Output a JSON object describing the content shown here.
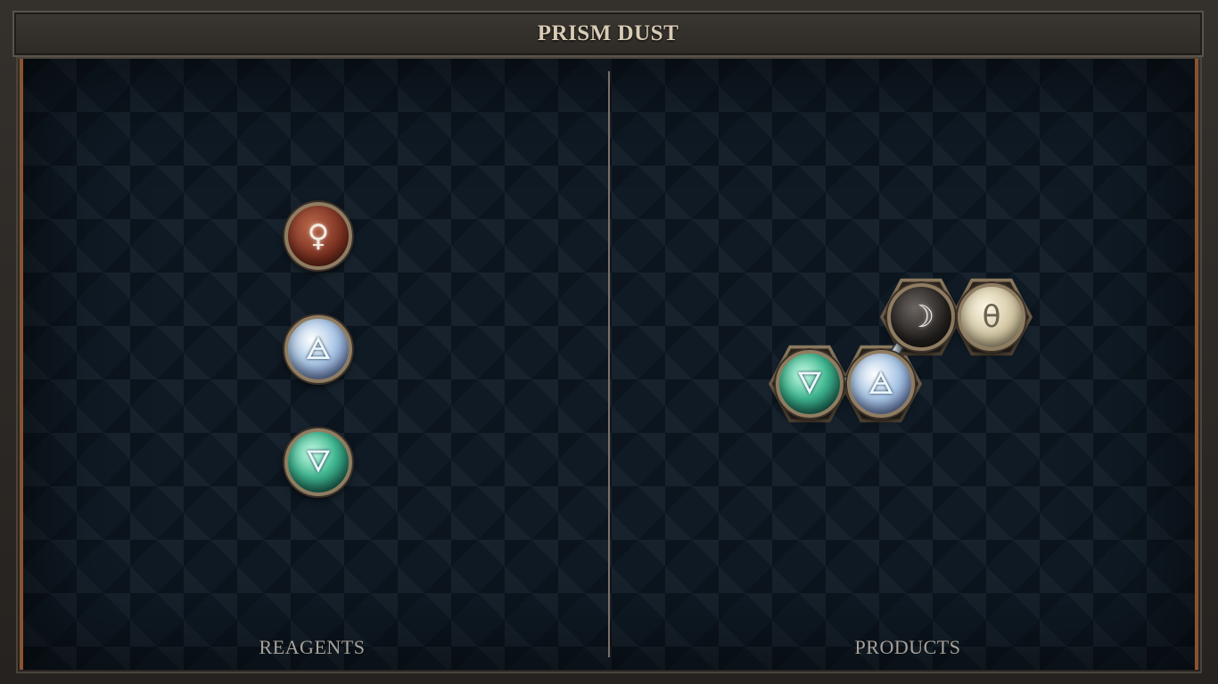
{
  "title": "PRISM DUST",
  "reagents": {
    "label": "REAGENTS",
    "atoms": [
      {
        "element": "copper",
        "glyph": "♀",
        "icon": "copper-icon"
      },
      {
        "element": "air",
        "glyph": "🜁",
        "icon": "air-icon"
      },
      {
        "element": "water",
        "glyph": "🜄",
        "icon": "water-icon"
      }
    ]
  },
  "products": {
    "label": "PRODUCTS",
    "atoms": [
      {
        "element": "water",
        "glyph": "🜄",
        "icon": "water-icon"
      },
      {
        "element": "air",
        "glyph": "🜁",
        "icon": "air-icon"
      },
      {
        "element": "silver",
        "glyph": "☽",
        "icon": "moon-icon"
      },
      {
        "element": "earth",
        "glyph": "θ",
        "icon": "earth-icon"
      }
    ]
  },
  "colors": {
    "frame_accent": "#8a5330",
    "board": "#0f1a24",
    "label_text": "#a8a29a",
    "title_text": "#d8cbb6"
  }
}
